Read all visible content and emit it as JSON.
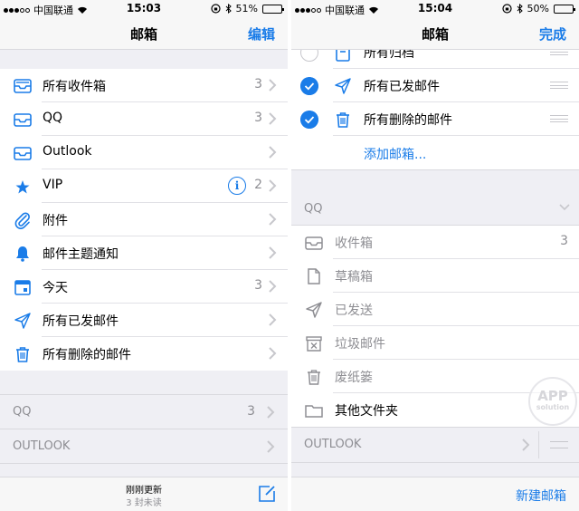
{
  "left": {
    "status": {
      "carrier": "中国联通",
      "time": "15:03",
      "battery": "51%",
      "battery_level": 0.51
    },
    "nav": {
      "title": "邮箱",
      "action": "编辑"
    },
    "mailboxes": [
      {
        "label": "所有收件箱",
        "count": "3",
        "icon": "tray-icon"
      },
      {
        "label": "QQ",
        "count": "3",
        "icon": "tray-icon"
      },
      {
        "label": "Outlook",
        "count": "",
        "icon": "tray-icon"
      },
      {
        "label": "VIP",
        "count": "2",
        "icon": "star-icon"
      },
      {
        "label": "附件",
        "count": "",
        "icon": "paperclip-icon"
      },
      {
        "label": "邮件主题通知",
        "count": "",
        "icon": "bell-icon"
      },
      {
        "label": "今天",
        "count": "3",
        "icon": "calendar-icon"
      },
      {
        "label": "所有已发邮件",
        "count": "",
        "icon": "paper-plane-icon"
      },
      {
        "label": "所有删除的邮件",
        "count": "",
        "icon": "trash-icon"
      }
    ],
    "accounts": [
      {
        "label": "QQ",
        "count": "3"
      },
      {
        "label": "OUTLOOK",
        "count": ""
      }
    ],
    "toolbar": {
      "updated": "刚刚更新",
      "unread": "3 封未读"
    }
  },
  "right": {
    "status": {
      "carrier": "中国联通",
      "time": "15:04",
      "battery": "50%",
      "battery_level": 0.5
    },
    "nav": {
      "title": "邮箱",
      "action": "完成"
    },
    "edit_items": [
      {
        "label": "所有归档",
        "checked": false,
        "icon": "archive-icon"
      },
      {
        "label": "所有已发邮件",
        "checked": true,
        "icon": "paper-plane-icon"
      },
      {
        "label": "所有删除的邮件",
        "checked": true,
        "icon": "trash-icon"
      }
    ],
    "add_mailbox": "添加邮箱...",
    "qq_section": "QQ",
    "qq_folders": [
      {
        "label": "收件箱",
        "count": "3",
        "icon": "tray-icon",
        "dark": false
      },
      {
        "label": "草稿箱",
        "count": "",
        "icon": "document-icon",
        "dark": false
      },
      {
        "label": "已发送",
        "count": "",
        "icon": "paper-plane-icon",
        "dark": false
      },
      {
        "label": "垃圾邮件",
        "count": "",
        "icon": "junk-icon",
        "dark": false
      },
      {
        "label": "废纸篓",
        "count": "",
        "icon": "trash-icon",
        "dark": false
      },
      {
        "label": "其他文件夹",
        "count": "",
        "icon": "folder-icon",
        "dark": true
      }
    ],
    "outlook_section": "OUTLOOK",
    "toolbar": {
      "new_mailbox": "新建邮箱"
    }
  },
  "watermark": {
    "line1": "APP",
    "line2": "solution"
  }
}
